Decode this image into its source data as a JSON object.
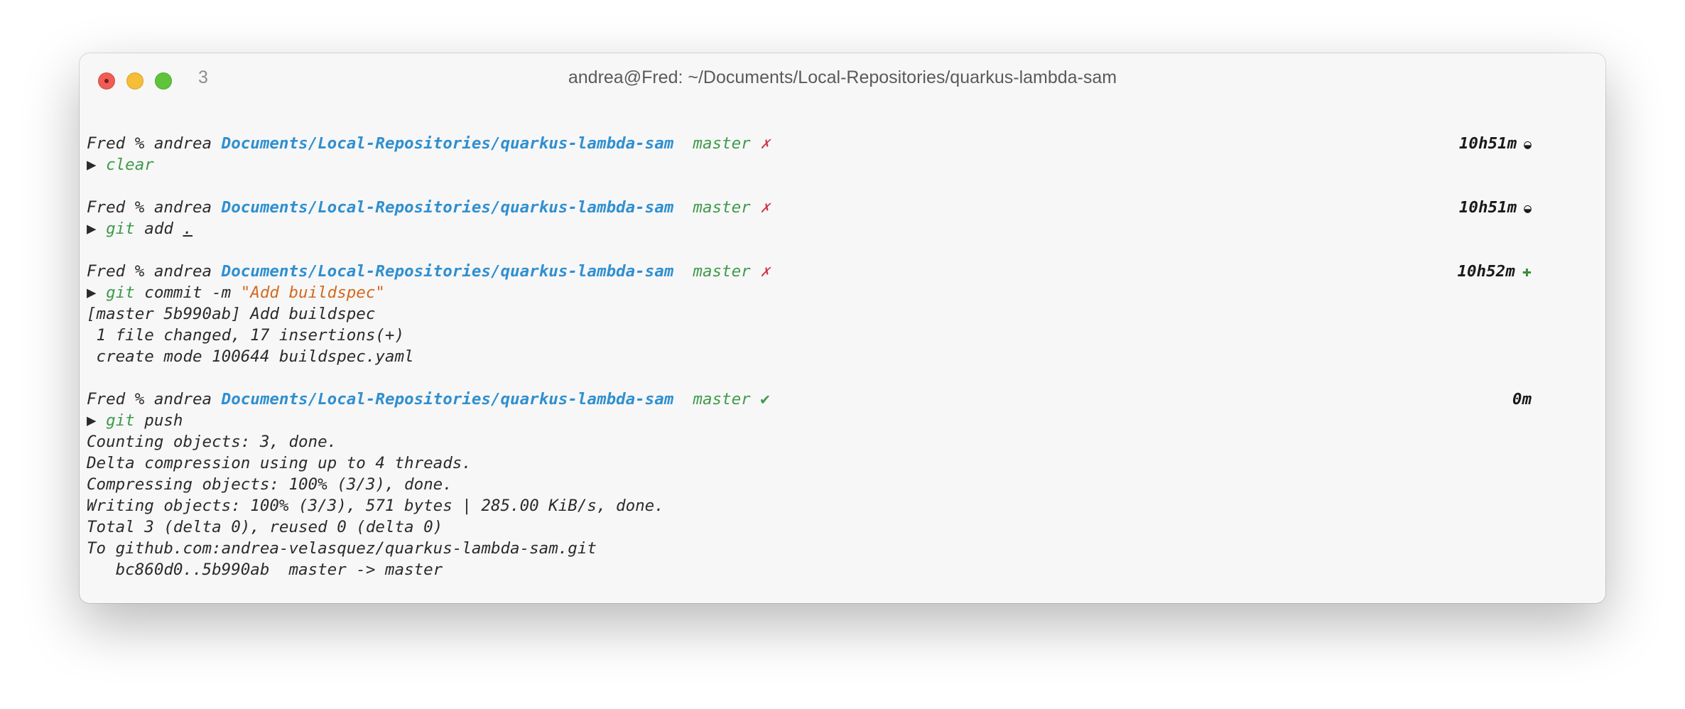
{
  "window": {
    "title": "andrea@Fred: ~/Documents/Local-Repositories/quarkus-lambda-sam",
    "tab_index": "3"
  },
  "colors": {
    "path": "#2f8fd0",
    "branch": "#3f9a4c",
    "dirty": "#d2334a",
    "string": "#d2691e"
  },
  "prompts": [
    {
      "host": "Fred % andrea",
      "path": "Documents/Local-Repositories/quarkus-lambda-sam",
      "branch": "master",
      "status_icon": "✗",
      "timer": "10h51m",
      "timer_icon": "◒",
      "arrow": "▶",
      "cmd": "clear",
      "args": "",
      "arg_extra": "",
      "output": []
    },
    {
      "host": "Fred % andrea",
      "path": "Documents/Local-Repositories/quarkus-lambda-sam",
      "branch": "master",
      "status_icon": "✗",
      "timer": "10h51m",
      "timer_icon": "◒",
      "arrow": "▶",
      "cmd": "git",
      "args": " add ",
      "arg_extra": ".",
      "output": []
    },
    {
      "host": "Fred % andrea",
      "path": "Documents/Local-Repositories/quarkus-lambda-sam",
      "branch": "master",
      "status_icon": "✗",
      "timer": "10h52m",
      "timer_icon": "✚",
      "arrow": "▶",
      "cmd": "git",
      "args": " commit -m ",
      "arg_extra": "\"Add buildspec\"",
      "output": [
        "[master 5b990ab] Add buildspec",
        " 1 file changed, 17 insertions(+)",
        " create mode 100644 buildspec.yaml"
      ]
    },
    {
      "host": "Fred % andrea",
      "path": "Documents/Local-Repositories/quarkus-lambda-sam",
      "branch": "master",
      "status_icon": "✔",
      "timer": "0m",
      "timer_icon": "",
      "arrow": "▶",
      "cmd": "git",
      "args": " push",
      "arg_extra": "",
      "output": [
        "Counting objects: 3, done.",
        "Delta compression using up to 4 threads.",
        "Compressing objects: 100% (3/3), done.",
        "Writing objects: 100% (3/3), 571 bytes | 285.00 KiB/s, done.",
        "Total 3 (delta 0), reused 0 (delta 0)",
        "To github.com:andrea-velasquez/quarkus-lambda-sam.git",
        "   bc860d0..5b990ab  master -> master"
      ]
    }
  ]
}
